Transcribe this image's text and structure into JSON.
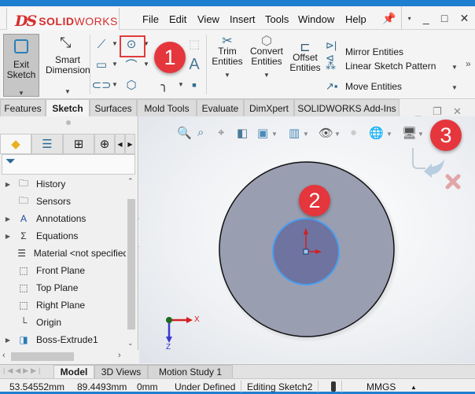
{
  "app": {
    "logo_ds": "DS",
    "logo_bold": "SOLID",
    "logo_light": "WORKS"
  },
  "menu": [
    "File",
    "Edit",
    "View",
    "Insert",
    "Tools",
    "Window",
    "Help"
  ],
  "window_controls": {
    "pin": "pin-icon",
    "more": "▾",
    "minimize": "_",
    "maximize": "□",
    "close": "✕"
  },
  "ribbon": {
    "exit_sketch": "Exit Sketch",
    "smart_dimension": "Smart Dimension",
    "trim_entities": "Trim Entities",
    "convert_entities": "Convert Entities",
    "offset_entities": "Offset Entities",
    "mirror_entities": "Mirror Entities",
    "linear_sketch_pattern": "Linear Sketch Pattern",
    "move_entities": "Move Entities",
    "overflow": "»",
    "text_tool": "A"
  },
  "tabs": [
    "Features",
    "Sketch",
    "Surfaces",
    "Mold Tools",
    "Evaluate",
    "DimXpert",
    "SOLIDWORKS Add-Ins"
  ],
  "active_tab": "Sketch",
  "badges": {
    "one": "1",
    "two": "2",
    "three": "3"
  },
  "badge_color": "#e4363c",
  "accent_color": "#1e7fd0",
  "tree": [
    {
      "label": "History",
      "expandable": true,
      "icon": "history-folder-icon"
    },
    {
      "label": "Sensors",
      "expandable": false,
      "icon": "sensors-folder-icon"
    },
    {
      "label": "Annotations",
      "expandable": true,
      "icon": "annotations-folder-icon"
    },
    {
      "label": "Equations",
      "expandable": true,
      "icon": "equations-folder-icon"
    },
    {
      "label": "Material <not specified>",
      "expandable": false,
      "icon": "material-icon"
    },
    {
      "label": "Front Plane",
      "expandable": false,
      "icon": "plane-icon"
    },
    {
      "label": "Top Plane",
      "expandable": false,
      "icon": "plane-icon"
    },
    {
      "label": "Right Plane",
      "expandable": false,
      "icon": "plane-icon"
    },
    {
      "label": "Origin",
      "expandable": false,
      "icon": "origin-icon"
    },
    {
      "label": "Boss-Extrude1",
      "expandable": true,
      "icon": "extrude-icon"
    }
  ],
  "viewport": {
    "axis_x": "X",
    "axis_z": "Z"
  },
  "bottom_tabs": [
    "Model",
    "3D Views",
    "Motion Study 1"
  ],
  "active_bottom_tab": "Model",
  "status": {
    "x": "53.54552mm",
    "y": "89.4493mm",
    "z": "0mm",
    "definition": "Under Defined",
    "editing": "Editing Sketch2",
    "units": "MMGS",
    "units_arrow": "▲"
  }
}
